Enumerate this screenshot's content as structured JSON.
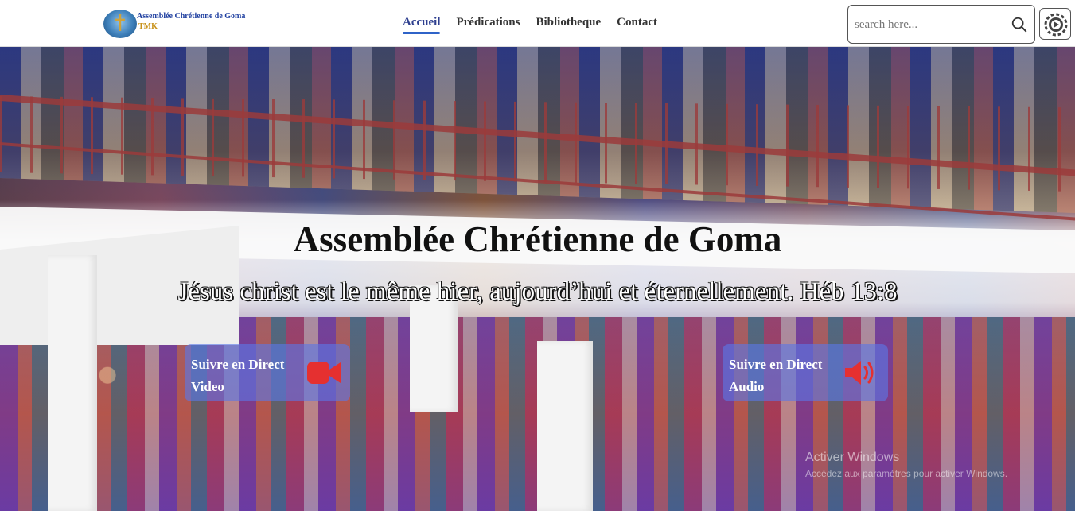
{
  "header": {
    "logo_line1": "Assemblée Chrétienne de Goma",
    "logo_line2": "TMK",
    "nav": [
      {
        "label": "Accueil",
        "active": true
      },
      {
        "label": "Prédications",
        "active": false
      },
      {
        "label": "Bibliotheque",
        "active": false
      },
      {
        "label": "Contact",
        "active": false
      }
    ],
    "search_placeholder": "search here...",
    "search_icon": "search-icon",
    "settings_icon": "gear-icon"
  },
  "hero": {
    "title": "Assemblée Chrétienne de Goma",
    "verse": "Jésus christ est le même hier, aujourd’hui et éternellement. Héb 13:8",
    "video_card": {
      "line1": "Suivre en Direct",
      "line2": "Video",
      "icon": "video-camera-icon"
    },
    "audio_card": {
      "line1": "Suivre en Direct",
      "line2": "Audio",
      "icon": "speaker-icon"
    },
    "watermark_line1": "Activer Windows",
    "watermark_line2": "Accédez aux paramètres pour activer Windows."
  },
  "colors": {
    "accent": "#2f63c8",
    "nav_active": "#2e3f8f",
    "card_bg": "#5a78e6",
    "icon_red": "#e53030"
  }
}
